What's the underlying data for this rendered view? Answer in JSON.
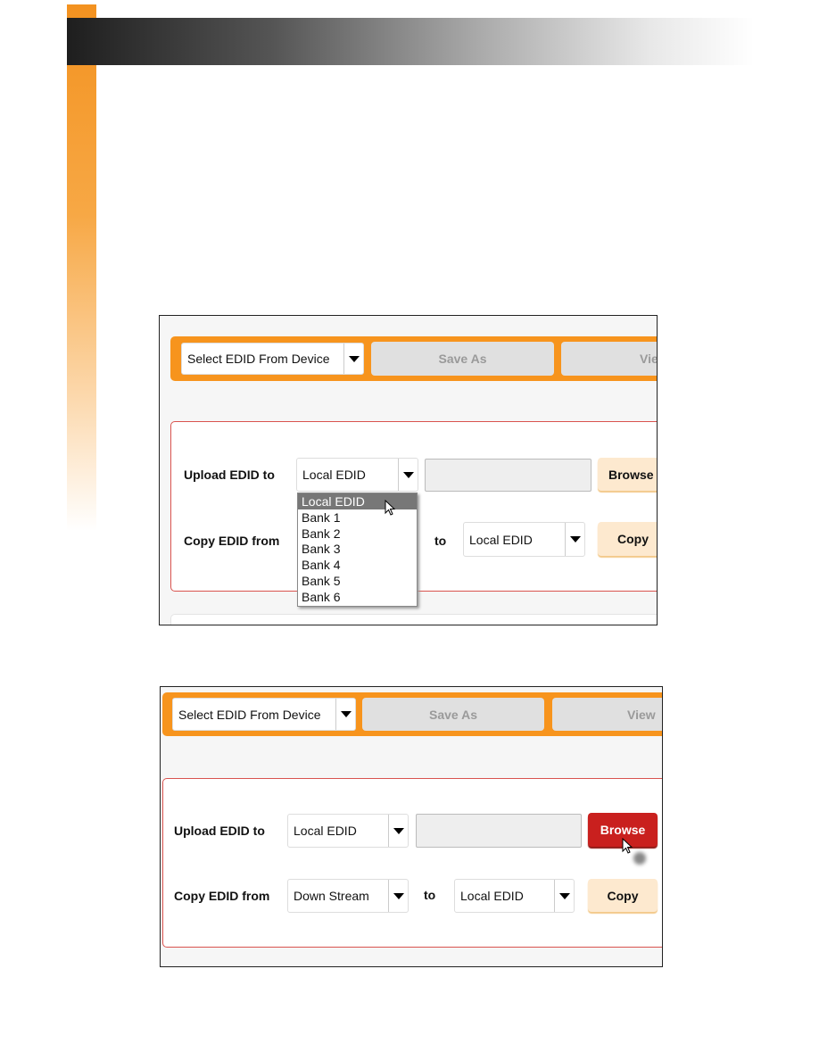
{
  "figure1": {
    "toolbar": {
      "device_select": "Select EDID From Device",
      "save_as": "Save As",
      "view": "View"
    },
    "upload_label": "Upload EDID to",
    "upload_select": "Local EDID",
    "browse": "Browse",
    "copy_label": "Copy EDID from",
    "to": "to",
    "copy_to_select": "Local EDID",
    "copy": "Copy",
    "dropdown_options": [
      "Local EDID",
      "Bank 1",
      "Bank 2",
      "Bank 3",
      "Bank 4",
      "Bank 5",
      "Bank 6"
    ],
    "dropdown_highlighted": "Local EDID"
  },
  "figure2": {
    "toolbar": {
      "device_select": "Select EDID From Device",
      "save_as": "Save As",
      "view": "View"
    },
    "upload_label": "Upload EDID to",
    "upload_select": "Local EDID",
    "browse": "Browse",
    "copy_label": "Copy EDID from",
    "copy_from_select": "Down Stream",
    "to": "to",
    "copy_to_select": "Local EDID",
    "copy": "Copy"
  },
  "colors": {
    "accent": "#f7941d",
    "panel_border": "#d9534f",
    "browse_active": "#c9201e"
  }
}
